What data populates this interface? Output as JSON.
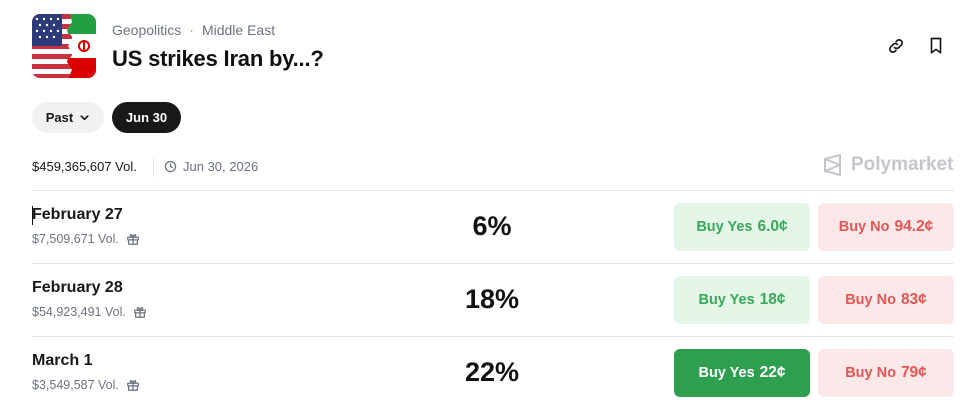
{
  "header": {
    "category": "Geopolitics",
    "subcategory": "Middle East",
    "separator": "·",
    "title": "US strikes Iran by...?"
  },
  "filters": {
    "past_label": "Past",
    "active_date_label": "Jun 30"
  },
  "meta": {
    "volume": "$459,365,607 Vol.",
    "end_date": "Jun 30, 2026",
    "brand": "Polymarket"
  },
  "rows": [
    {
      "name": "February 27",
      "volume": "$7,509,671 Vol.",
      "chance": "6%",
      "yes_label": "Buy Yes",
      "yes_price": "6.0¢",
      "no_label": "Buy No",
      "no_price": "94.2¢"
    },
    {
      "name": "February 28",
      "volume": "$54,923,491 Vol.",
      "chance": "18%",
      "yes_label": "Buy Yes",
      "yes_price": "18¢",
      "no_label": "Buy No",
      "no_price": "83¢"
    },
    {
      "name": "March 1",
      "volume": "$3,549,587 Vol.",
      "chance": "22%",
      "yes_label": "Buy Yes",
      "yes_price": "22¢",
      "no_label": "Buy No",
      "no_price": "79¢"
    }
  ],
  "colors": {
    "yes_bg": "#e3f6e8",
    "yes_text": "#3aa85a",
    "yes_active_bg": "#2e9e4f",
    "no_bg": "#fbe8e8",
    "no_text": "#e35656"
  },
  "icons": {
    "link": "link-icon",
    "bookmark": "bookmark-icon",
    "chevron": "chevron-down-icon",
    "clock": "clock-icon",
    "gift": "gift-icon",
    "brand": "polymarket-logo-icon"
  }
}
